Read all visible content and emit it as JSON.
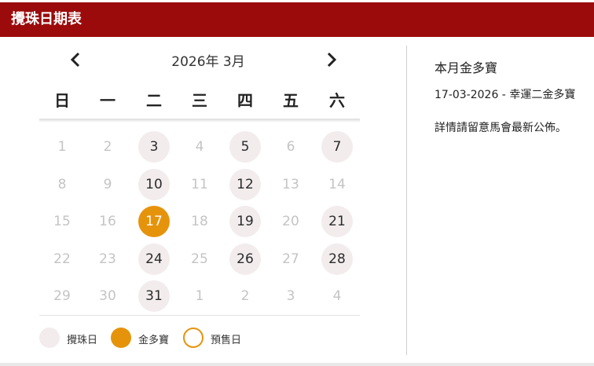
{
  "header": {
    "title": "攪珠日期表"
  },
  "calendar": {
    "month_label": "2026年 3月",
    "weekdays": [
      "日",
      "一",
      "二",
      "三",
      "四",
      "五",
      "六"
    ],
    "weeks": [
      [
        {
          "d": "1",
          "s": "muted"
        },
        {
          "d": "2",
          "s": "muted"
        },
        {
          "d": "3",
          "s": "draw"
        },
        {
          "d": "4",
          "s": "muted"
        },
        {
          "d": "5",
          "s": "draw"
        },
        {
          "d": "6",
          "s": "muted"
        },
        {
          "d": "7",
          "s": "draw"
        }
      ],
      [
        {
          "d": "8",
          "s": "muted"
        },
        {
          "d": "9",
          "s": "muted"
        },
        {
          "d": "10",
          "s": "draw"
        },
        {
          "d": "11",
          "s": "muted"
        },
        {
          "d": "12",
          "s": "draw"
        },
        {
          "d": "13",
          "s": "muted"
        },
        {
          "d": "14",
          "s": "muted"
        }
      ],
      [
        {
          "d": "15",
          "s": "muted"
        },
        {
          "d": "16",
          "s": "muted"
        },
        {
          "d": "17",
          "s": "jackpot"
        },
        {
          "d": "18",
          "s": "muted"
        },
        {
          "d": "19",
          "s": "draw"
        },
        {
          "d": "20",
          "s": "muted"
        },
        {
          "d": "21",
          "s": "draw"
        }
      ],
      [
        {
          "d": "22",
          "s": "muted"
        },
        {
          "d": "23",
          "s": "muted"
        },
        {
          "d": "24",
          "s": "draw"
        },
        {
          "d": "25",
          "s": "muted"
        },
        {
          "d": "26",
          "s": "draw"
        },
        {
          "d": "27",
          "s": "muted"
        },
        {
          "d": "28",
          "s": "draw"
        }
      ],
      [
        {
          "d": "29",
          "s": "muted"
        },
        {
          "d": "30",
          "s": "muted"
        },
        {
          "d": "31",
          "s": "draw"
        },
        {
          "d": "1",
          "s": "muted"
        },
        {
          "d": "2",
          "s": "muted"
        },
        {
          "d": "3",
          "s": "muted"
        },
        {
          "d": "4",
          "s": "muted"
        }
      ]
    ]
  },
  "legend": {
    "draw": "攪珠日",
    "jackpot": "金多寶",
    "presale": "預售日"
  },
  "side": {
    "title": "本月金多寶",
    "line1": "17-03-2026 - 幸運二金多寶",
    "line2": "詳情請留意馬會最新公佈。"
  },
  "colors": {
    "brand_red": "#9b0b0b",
    "jackpot_orange": "#e6930c",
    "draw_day_bg": "#f2eced"
  },
  "icons": {
    "prev": "chevron-left-icon",
    "next": "chevron-right-icon"
  }
}
